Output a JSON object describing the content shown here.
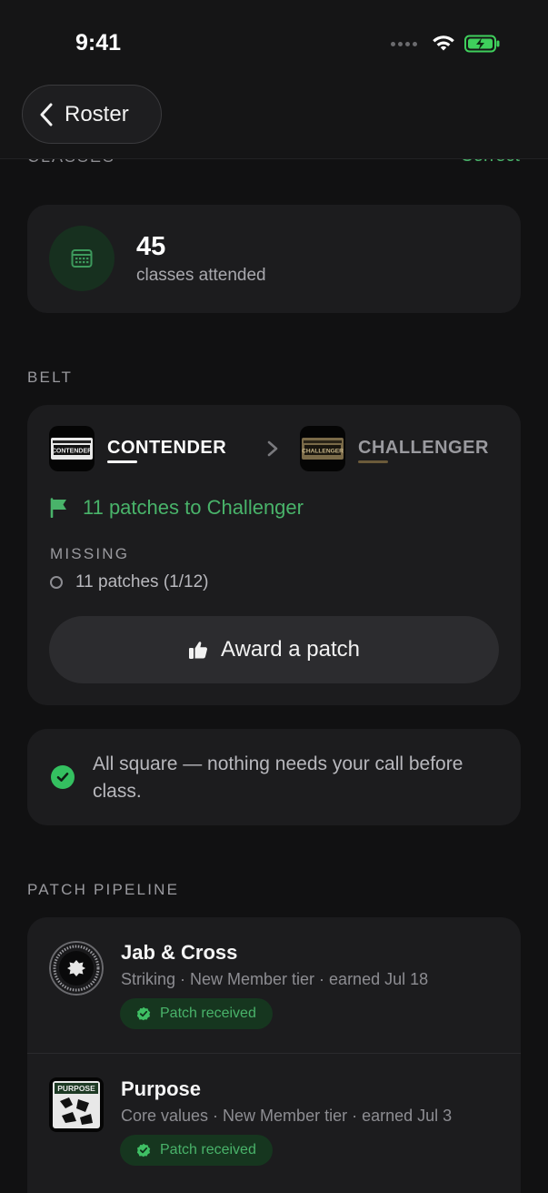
{
  "status_bar": {
    "time": "9:41"
  },
  "nav": {
    "back_label": "Roster"
  },
  "classes_section": {
    "label": "CLASSES",
    "action": "Correct"
  },
  "classes_card": {
    "count": "45",
    "subtitle": "classes attended",
    "icon": "calendar-icon"
  },
  "belt": {
    "label": "BELT",
    "current": {
      "name": "CONTENDER",
      "thumb_text": "CONTENDER",
      "accent": "#ffffff"
    },
    "next": {
      "name": "CHALLENGER",
      "thumb_text": "CHALLENGER",
      "accent": "#6b5a3a"
    },
    "progress_text": "11 patches to Challenger",
    "missing_label": "MISSING",
    "missing_items": [
      "11 patches (1/12)"
    ],
    "award_button": "Award a patch"
  },
  "status_message": "All square — nothing needs your call before class.",
  "pipeline": {
    "label": "PATCH PIPELINE",
    "items": [
      {
        "title": "Jab & Cross",
        "meta": "Striking · New Member tier · earned Jul 18",
        "badge": "Patch received"
      },
      {
        "title": "Purpose",
        "meta": "Core values · New Member tier · earned Jul 3",
        "badge": "Patch received",
        "thumb_text": "PURPOSE"
      }
    ]
  },
  "colors": {
    "accent_green": "#49b36a",
    "background": "#111112",
    "card": "#1c1c1e"
  }
}
